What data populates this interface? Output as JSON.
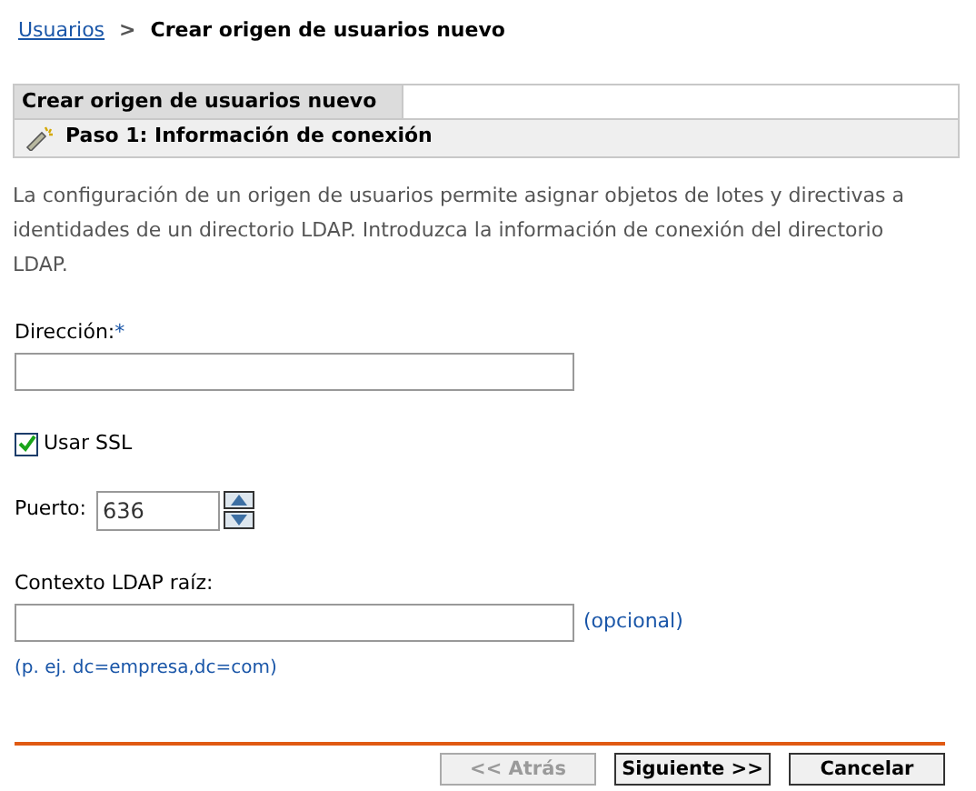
{
  "breadcrumb": {
    "link": "Usuarios",
    "separator": ">",
    "current": "Crear origen de usuarios nuevo"
  },
  "panel": {
    "title": "Crear origen de usuarios nuevo",
    "step": "Paso 1: Información de conexión"
  },
  "description": "La configuración de un origen de usuarios permite asignar objetos de lotes y directivas a identidades de un directorio LDAP. Introduzca la información de conexión del directorio LDAP.",
  "address": {
    "label": "Dirección:",
    "required_mark": "*"
  },
  "ssl": {
    "label": "Usar SSL",
    "checked": true
  },
  "port": {
    "label": "Puerto:",
    "value": "636"
  },
  "context": {
    "label": "Contexto LDAP raíz:",
    "optional": "(opcional)",
    "example": "(p. ej. dc=empresa,dc=com)"
  },
  "buttons": [
    {
      "label": "<< Atrás",
      "disabled": true
    },
    {
      "label": "Siguiente >>",
      "disabled": false
    },
    {
      "label": "Cancelar",
      "disabled": false
    }
  ]
}
